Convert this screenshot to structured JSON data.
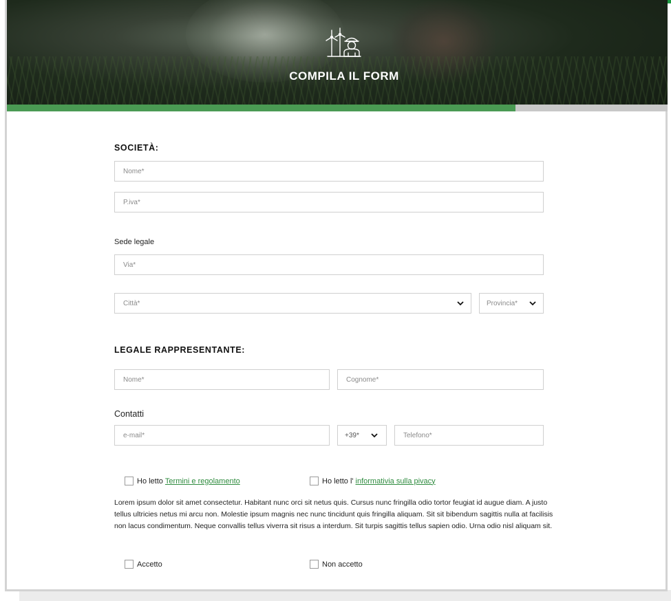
{
  "hero": {
    "title": "COMPILA IL FORM",
    "icon": "wind-turbine-worker-icon",
    "progress_percent": 77
  },
  "societa": {
    "title": "SOCIETÀ:",
    "nome_placeholder": "Nome*",
    "piva_placeholder": "P.iva*",
    "sede_label": "Sede legale",
    "via_placeholder": "Via*",
    "citta_placeholder": "Città*",
    "provincia_placeholder": "Provincia*"
  },
  "rappresentante": {
    "title": "LEGALE RAPPRESENTANTE:",
    "nome_placeholder": "Nome*",
    "cognome_placeholder": "Cognome*",
    "contatti_label": "Contatti",
    "email_placeholder": "e-mail*",
    "prefix_value": "+39*",
    "telefono_placeholder": "Telefono*"
  },
  "consent": {
    "terms_prefix": "Ho letto",
    "terms_link": "Termini e regolamento",
    "privacy_prefix": "Ho letto l'",
    "privacy_link": "informativia sulla pivacy",
    "body": "Lorem ipsum dolor sit amet consectetur. Habitant nunc orci sit netus quis. Cursus nunc fringilla odio tortor feugiat id augue diam. A justo tellus ultricies netus mi arcu non. Molestie ipsum magnis nec nunc tincidunt quis fringilla aliquam. Sit sit bibendum sagittis nulla at facilisis non lacus condimentum. Neque convallis tellus viverra sit risus a interdum. Sit turpis sagittis tellus sapien odio. Urna odio nisl aliquam sit.",
    "accept_label": "Accetto",
    "reject_label": "Non accetto"
  },
  "colors": {
    "accent_green": "#4a9a53",
    "link_green": "#2e8b3e",
    "border_grey": "#cfcfcf"
  }
}
